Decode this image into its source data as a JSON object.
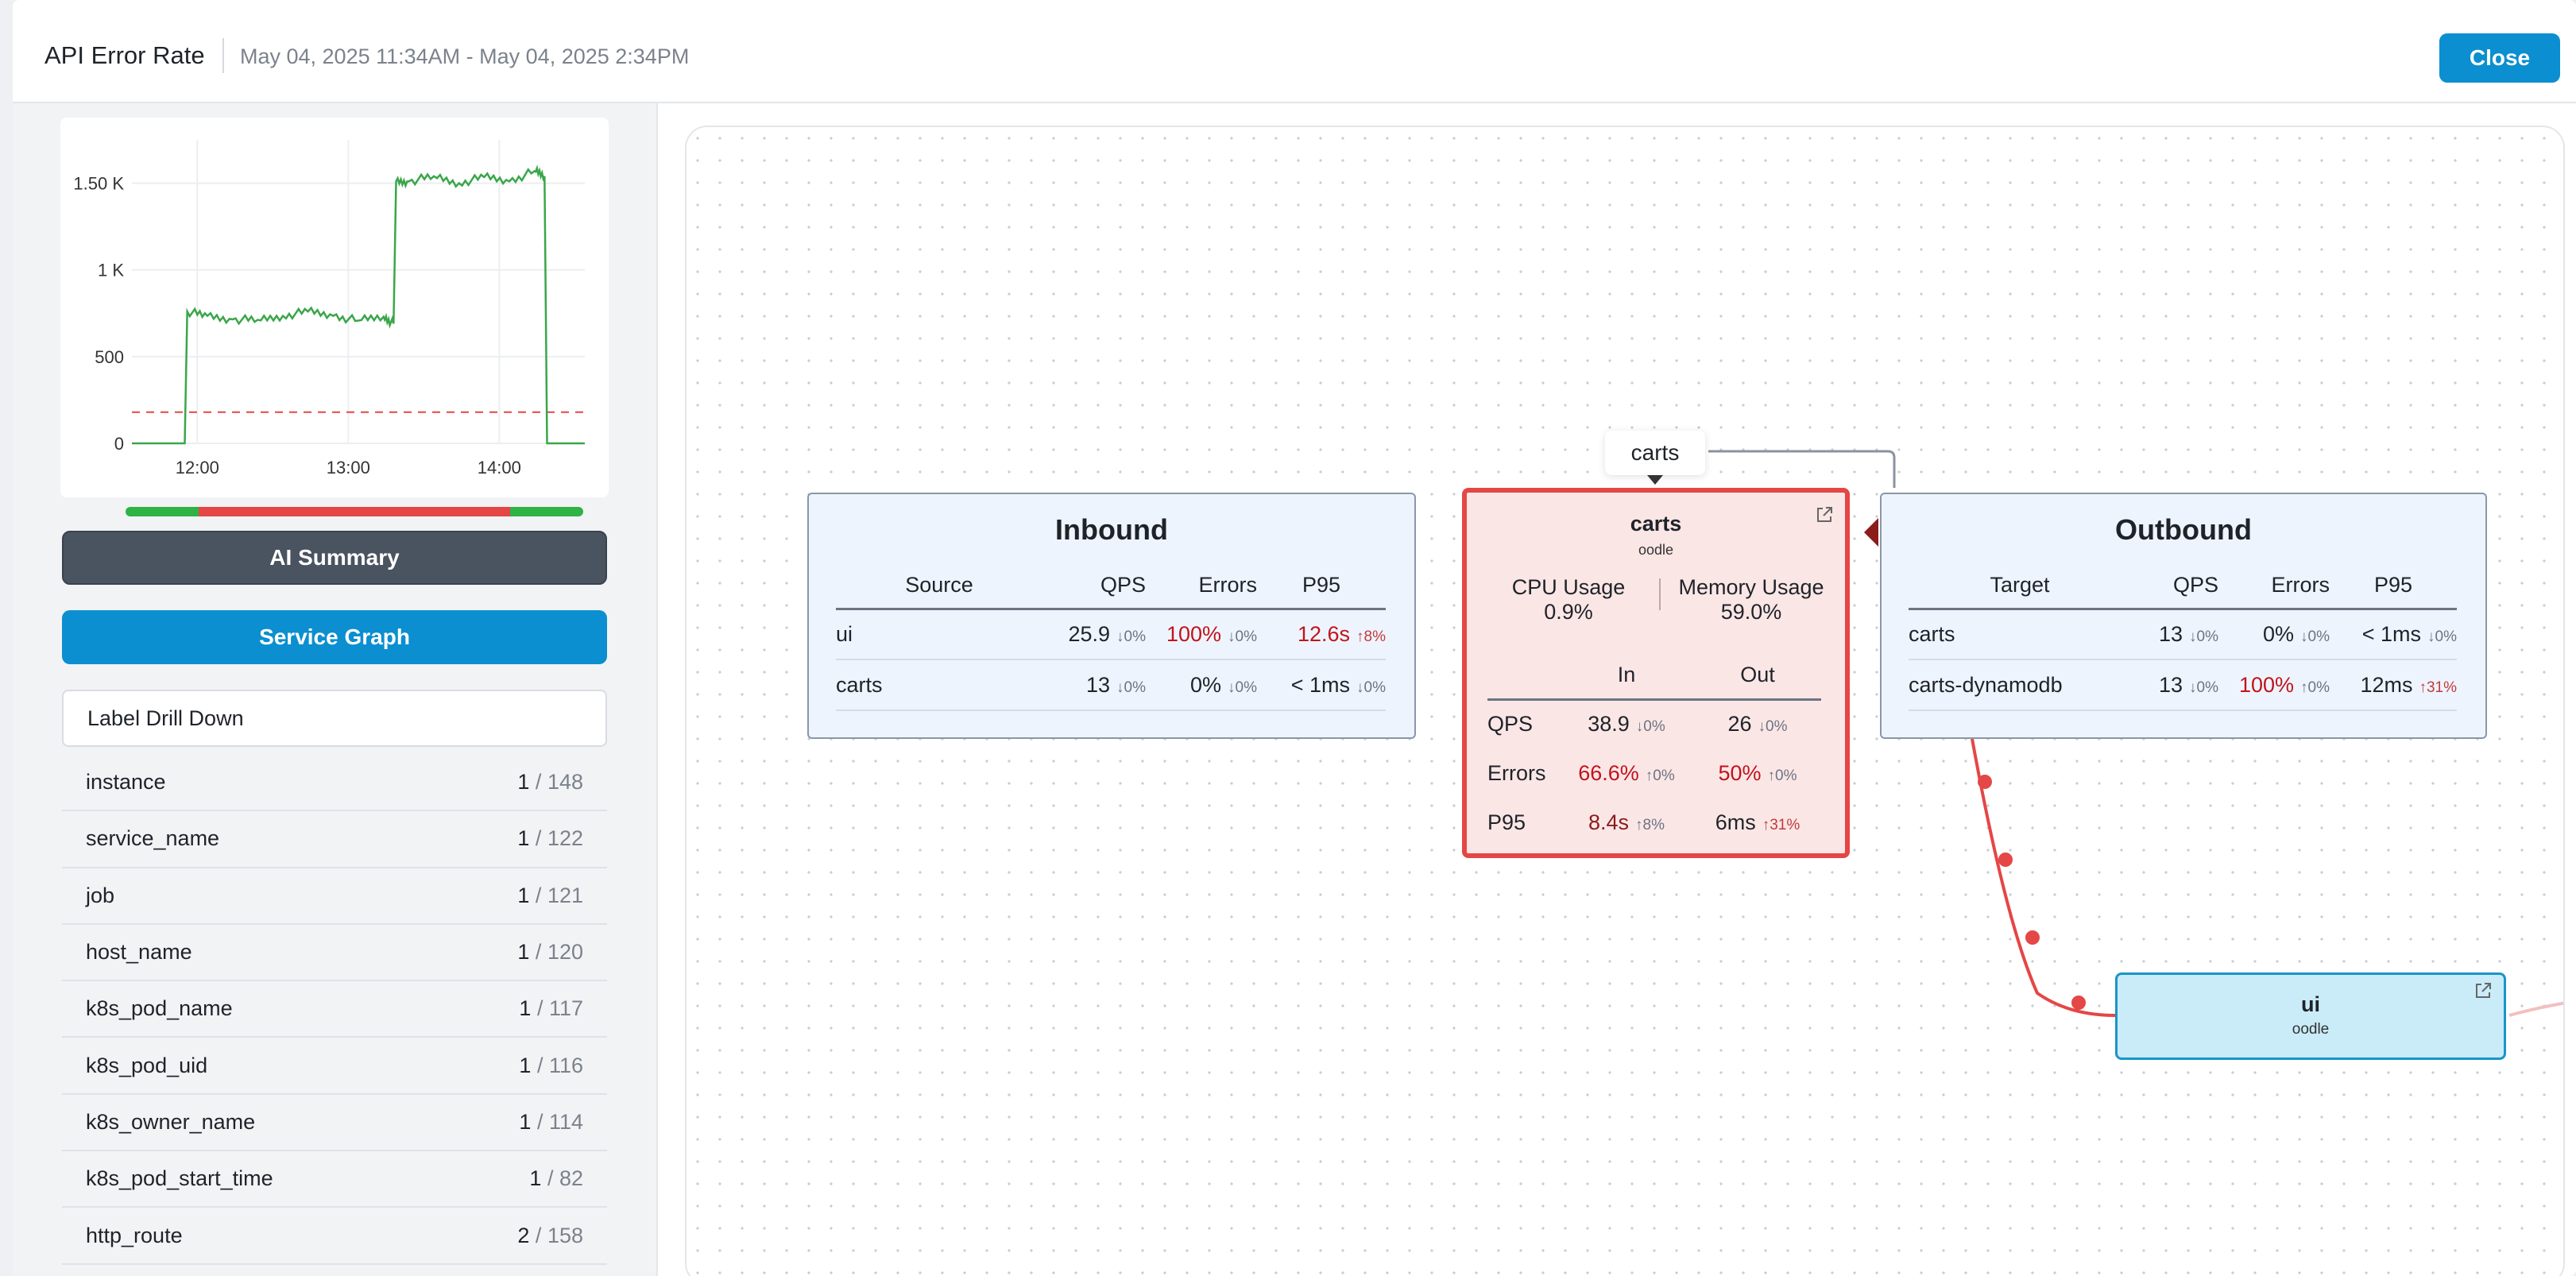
{
  "header": {
    "title": "API Error Rate",
    "date_range": "May 04, 2025 11:34AM - May 04, 2025 2:34PM",
    "close_label": "Close"
  },
  "sidebar": {
    "chart_data": {
      "type": "line",
      "y_ticks": [
        "1.50 K",
        "1 K",
        "500",
        "0"
      ],
      "x_ticks": [
        "12:00",
        "13:00",
        "14:00"
      ],
      "ylim": [
        0,
        1750
      ],
      "threshold": 180,
      "series": [
        {
          "x_minutes": [
            0,
            21,
            22,
            30,
            40,
            50,
            60,
            70,
            80,
            90,
            100,
            104,
            105,
            110,
            120,
            130,
            140,
            150,
            160,
            164,
            165,
            180
          ],
          "y": [
            0,
            0,
            760,
            735,
            715,
            712,
            735,
            760,
            735,
            708,
            730,
            690,
            1510,
            1510,
            1540,
            1500,
            1535,
            1510,
            1570,
            1540,
            0,
            0
          ]
        }
      ],
      "status_bar": [
        {
          "fraction": 0.16,
          "color": "#2fb344"
        },
        {
          "fraction": 0.68,
          "color": "#e54646"
        },
        {
          "fraction": 0.16,
          "color": "#2fb344"
        }
      ]
    },
    "ai_summary_label": "AI Summary",
    "service_graph_label": "Service Graph",
    "drill_down_label": "Label Drill Down",
    "labels": [
      {
        "name": "instance",
        "count": "1",
        "total": "148"
      },
      {
        "name": "service_name",
        "count": "1",
        "total": "122"
      },
      {
        "name": "job",
        "count": "1",
        "total": "121"
      },
      {
        "name": "host_name",
        "count": "1",
        "total": "120"
      },
      {
        "name": "k8s_pod_name",
        "count": "1",
        "total": "117"
      },
      {
        "name": "k8s_pod_uid",
        "count": "1",
        "total": "116"
      },
      {
        "name": "k8s_owner_name",
        "count": "1",
        "total": "114"
      },
      {
        "name": "k8s_pod_start_time",
        "count": "1",
        "total": "82"
      },
      {
        "name": "http_route",
        "count": "2",
        "total": "158"
      }
    ]
  },
  "graph": {
    "tooltip": "carts",
    "inbound": {
      "title": "Inbound",
      "headers": [
        "Source",
        "QPS",
        "Errors",
        "P95"
      ],
      "rows": [
        {
          "source": "ui",
          "qps": "25.9",
          "qps_d": "↓0%",
          "errors": "100%",
          "errors_d": "↓0%",
          "p95": "12.6s",
          "p95_d": "↑8%"
        },
        {
          "source": "carts",
          "qps": "13",
          "qps_d": "↓0%",
          "errors": "0%",
          "errors_d": "↓0%",
          "p95": "< 1ms",
          "p95_d": "↓0%"
        }
      ]
    },
    "center": {
      "name": "carts",
      "namespace": "oodle",
      "cpu_label": "CPU Usage",
      "cpu_value": "0.9%",
      "mem_label": "Memory Usage",
      "mem_value": "59.0%",
      "col_in": "In",
      "col_out": "Out",
      "rows": [
        {
          "label": "QPS",
          "in": "38.9",
          "in_d": "↓0%",
          "out": "26",
          "out_d": "↓0%"
        },
        {
          "label": "Errors",
          "in": "66.6%",
          "in_d": "↑0%",
          "out": "50%",
          "out_d": "↑0%"
        },
        {
          "label": "P95",
          "in": "8.4s",
          "in_d": "↑8%",
          "out": "6ms",
          "out_d": "↑31%"
        }
      ]
    },
    "outbound": {
      "title": "Outbound",
      "headers": [
        "Target",
        "QPS",
        "Errors",
        "P95"
      ],
      "rows": [
        {
          "target": "carts",
          "qps": "13",
          "qps_d": "↓0%",
          "errors": "0%",
          "errors_d": "↓0%",
          "p95": "< 1ms",
          "p95_d": "↓0%"
        },
        {
          "target": "carts-dynamodb",
          "qps": "13",
          "qps_d": "↓0%",
          "errors": "100%",
          "errors_d": "↑0%",
          "p95": "12ms",
          "p95_d": "↑31%"
        }
      ]
    },
    "ui_node": {
      "name": "ui",
      "namespace": "oodle"
    }
  },
  "colors": {
    "accent": "#0b8fd0",
    "error": "#e54646",
    "ok": "#2fb344",
    "line": "#3aa64a"
  }
}
